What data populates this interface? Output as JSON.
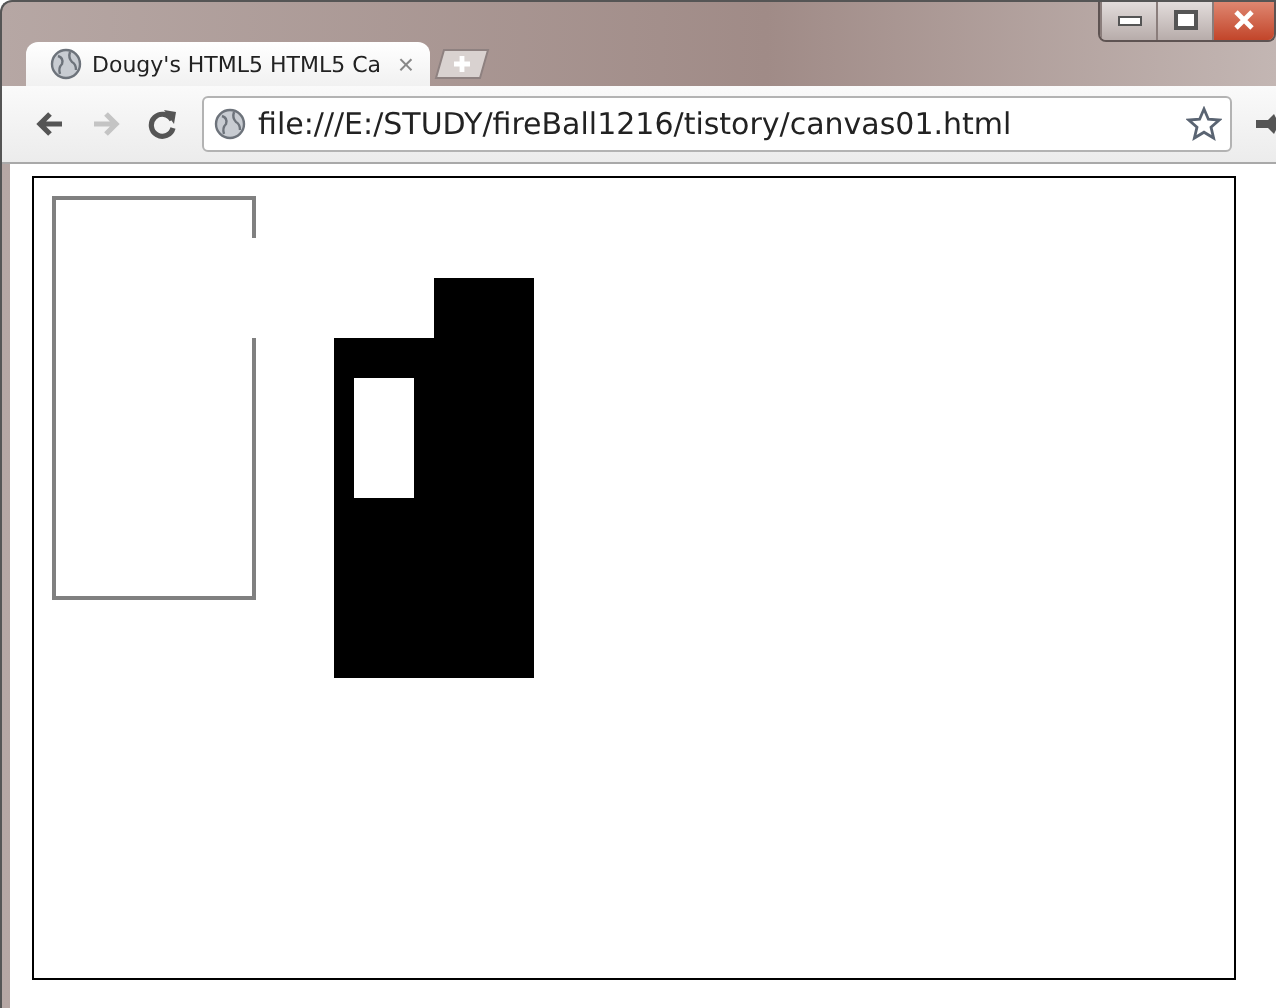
{
  "tab": {
    "title": "Dougy's HTML5 HTML5 Ca",
    "close": "×"
  },
  "toolbar": {
    "back_disabled": false,
    "forward_disabled": true
  },
  "address": {
    "url": "file:///E:/STUDY/fireBall1216/tistory/canvas01.html"
  }
}
